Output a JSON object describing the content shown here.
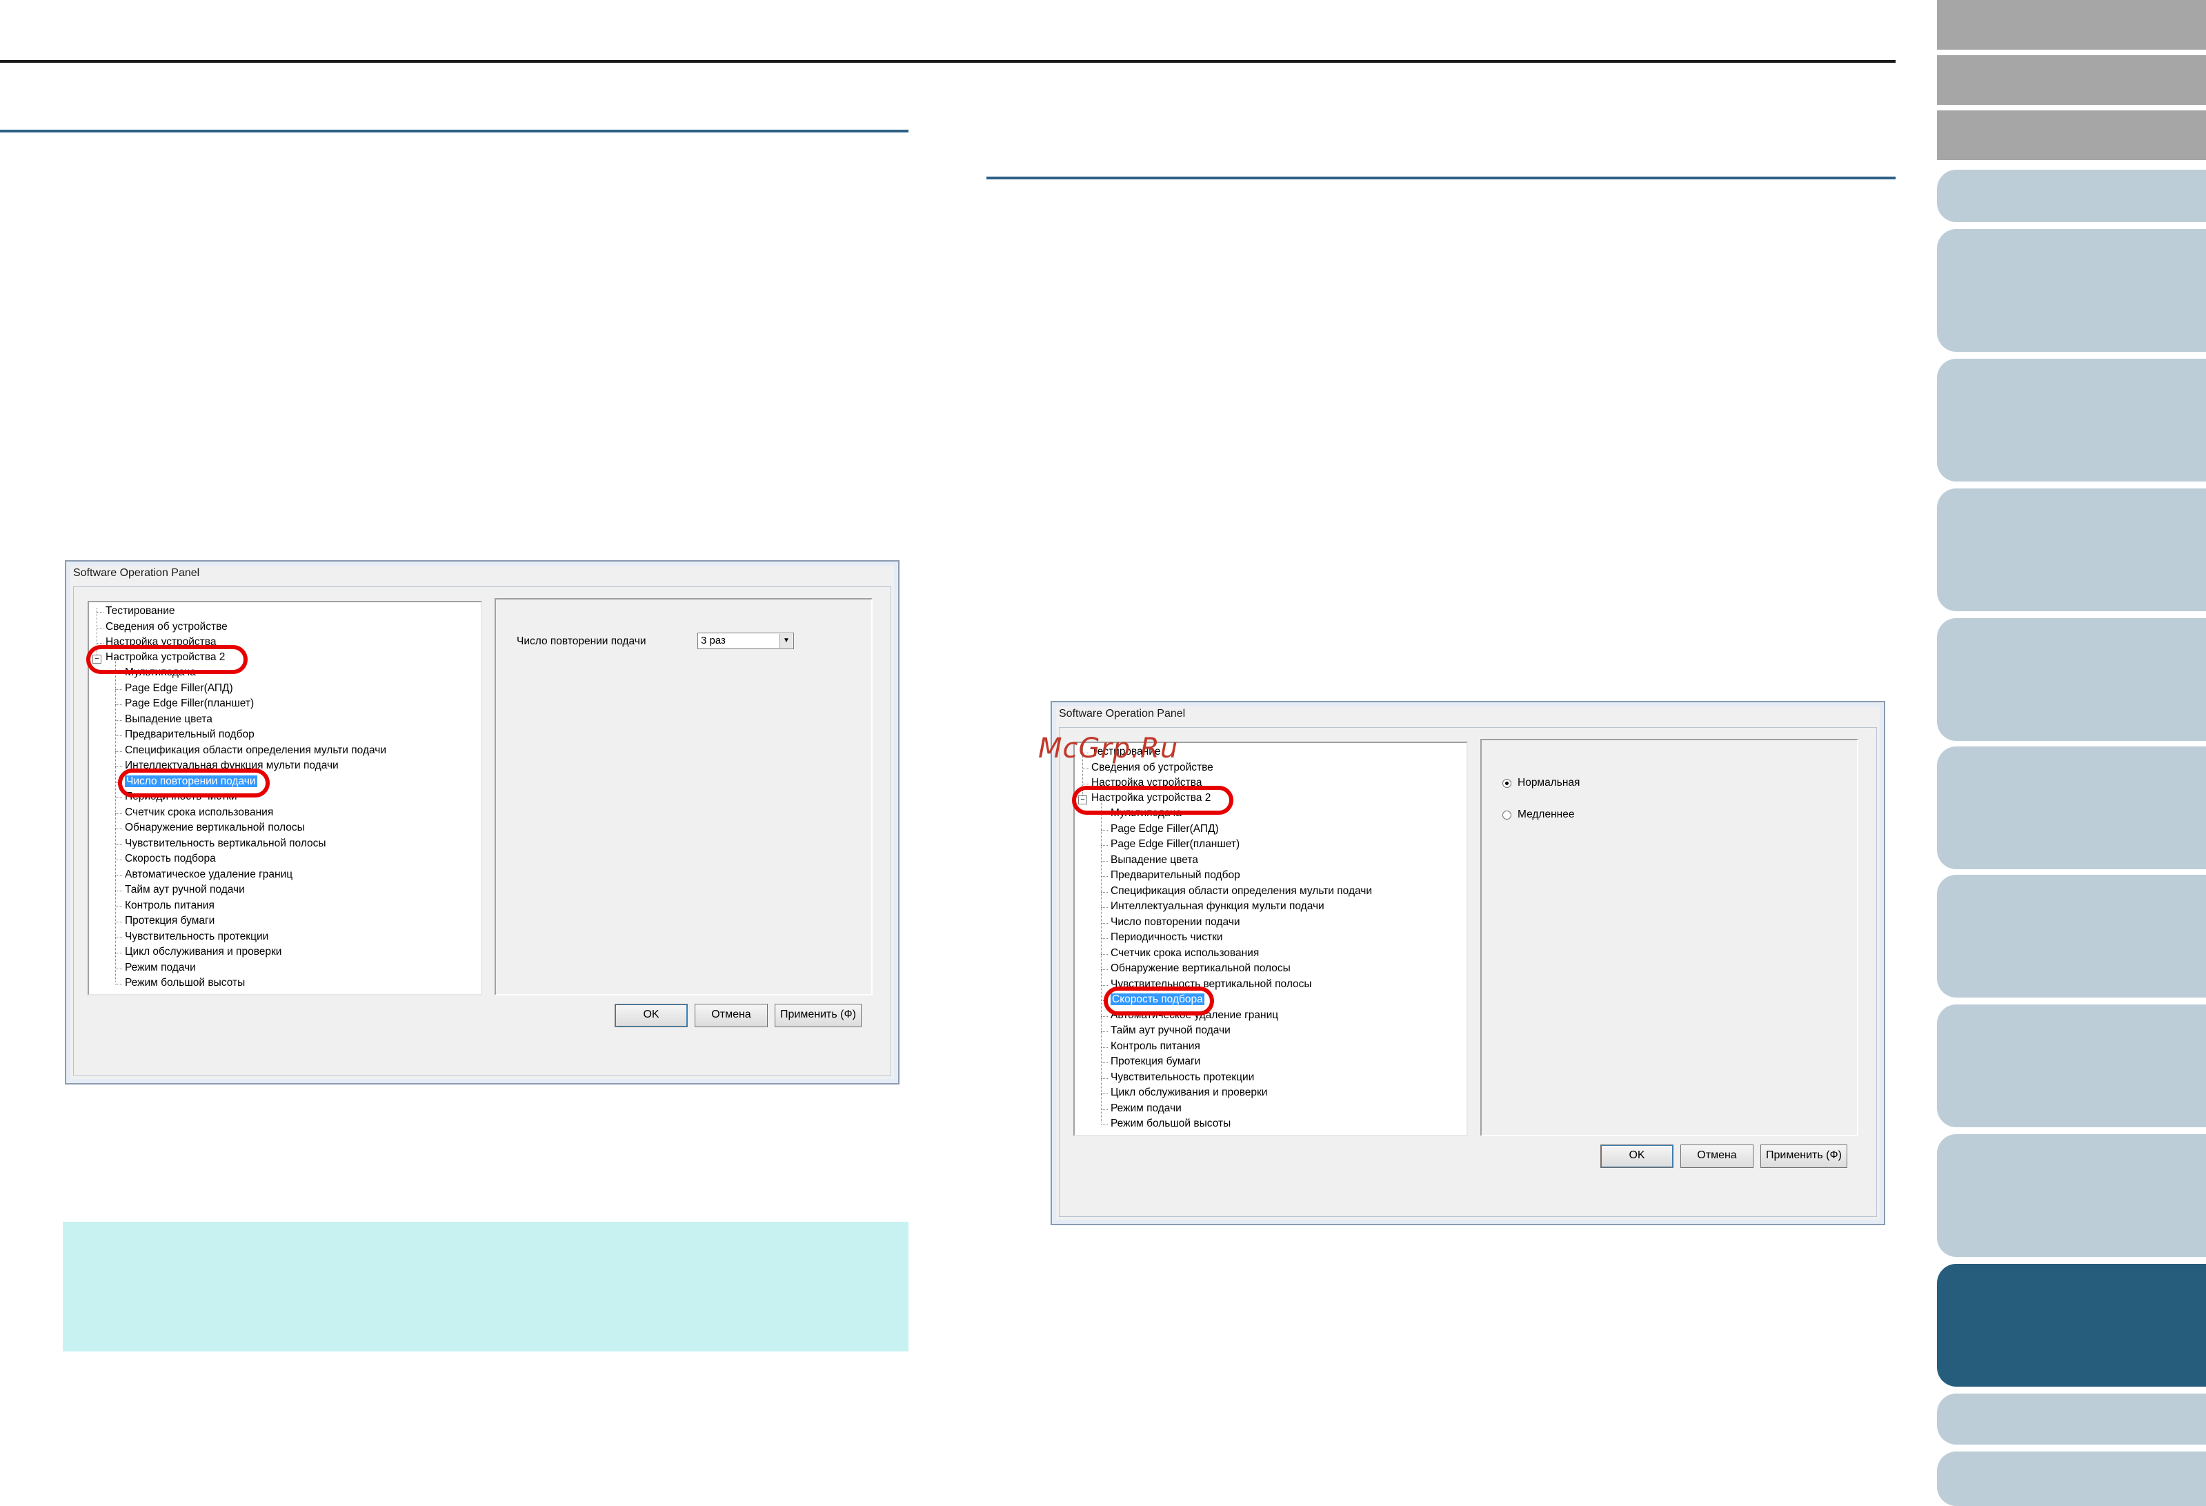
{
  "dialog_left": {
    "title": "Software Operation Panel",
    "tree": [
      "Тестирование",
      "Сведения об устройстве",
      "Настройка устройства",
      "Настройка устройства 2",
      "Мультиподача",
      "Page Edge Filler(АПД)",
      "Page Edge Filler(планшет)",
      "Выпадение цвета",
      "Предварительный подбор",
      "Спецификация области определения мульти подачи",
      "Интеллектуальная функция мульти подачи",
      "Число повторении подачи",
      "Периодичность чистки",
      "Счетчик срока использования",
      "Обнаружение вертикальной полосы",
      "Чувствительность вертикальной полосы",
      "Скорость подбора",
      "Автоматическое удаление границ",
      "Тайм аут ручной подачи",
      "Контроль питания",
      "Протекция бумаги",
      "Чувствительность протекции",
      "Цикл обслуживания и проверки",
      "Режим подачи",
      "Режим большой высоты"
    ],
    "setting_label": "Число повторении подачи",
    "setting_value": "3 раз",
    "buttons": {
      "ok": "OK",
      "cancel": "Отмена",
      "apply": "Применить (Ф)"
    }
  },
  "dialog_right": {
    "title": "Software Operation Panel",
    "tree": [
      "Тестирование",
      "Сведения об устройстве",
      "Настройка устройства",
      "Настройка устройства 2",
      "Мультиподача",
      "Page Edge Filler(АПД)",
      "Page Edge Filler(планшет)",
      "Выпадение цвета",
      "Предварительный подбор",
      "Спецификация области определения мульти подачи",
      "Интеллектуальная функция мульти подачи",
      "Число повторении подачи",
      "Периодичность чистки",
      "Счетчик срока использования",
      "Обнаружение вертикальной полосы",
      "Чувствительность вертикальной полосы",
      "Скорость подбора",
      "Автоматическое удаление границ",
      "Тайм аут ручной подачи",
      "Контроль питания",
      "Протекция бумаги",
      "Чувствительность протекции",
      "Цикл обслуживания и проверки",
      "Режим подачи",
      "Режим большой высоты"
    ],
    "radio_normal": "Нормальная",
    "radio_slow": "Медленнее",
    "buttons": {
      "ok": "OK",
      "cancel": "Отмена",
      "apply": "Применить (Ф)"
    }
  },
  "watermark": "McGrp.Ru",
  "colors": {
    "tab_inactive": "#bccdd8",
    "tab_active": "#275d7c",
    "tab_gray": "#a6a6a6",
    "note_bg": "#c8f2f2",
    "highlight_ring": "#e60000",
    "rule": "#2c5f86"
  }
}
